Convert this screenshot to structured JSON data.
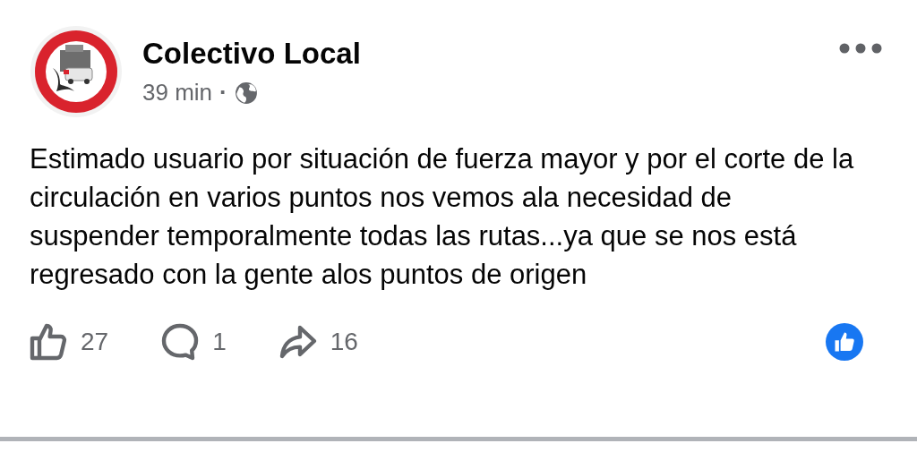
{
  "post": {
    "author": "Colectivo Local",
    "time": "39 min",
    "separator": "·",
    "text": "Estimado usuario por situación de fuerza mayor y por el corte de la circulación en varios puntos nos vemos ala necesidad de suspender temporalmente todas las rutas...ya que se nos está regresado con la gente alos puntos de origen"
  },
  "actions": [
    {
      "kind": "like",
      "count": "27"
    },
    {
      "kind": "comment",
      "count": "1"
    },
    {
      "kind": "share",
      "count": "16"
    }
  ]
}
